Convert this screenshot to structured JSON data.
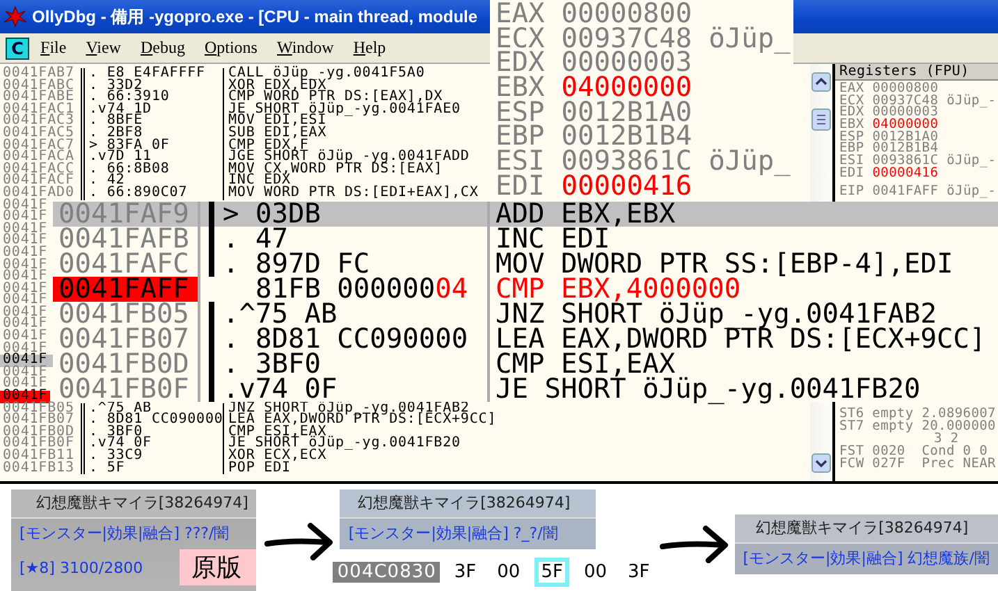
{
  "window": {
    "title": "OllyDbg - 備用 -ygopro.exe - [CPU - main thread, module"
  },
  "menu": {
    "system_button": "C",
    "items": [
      "File",
      "View",
      "Debug",
      "Options",
      "Window",
      "Help"
    ]
  },
  "disassembly": {
    "rows": [
      {
        "address": "0041FAB7",
        "hex": ". E8 E4FAFFFF",
        "instruction": "CALL öJüp_-yg.0041F5A0",
        "selected": false,
        "breakpoint": false
      },
      {
        "address": "0041FABC",
        "hex": ". 33D2",
        "instruction": "XOR EDX,EDX",
        "selected": false,
        "breakpoint": false
      },
      {
        "address": "0041FABE",
        "hex": ". 66:3910",
        "instruction": "CMP WORD PTR DS:[EAX],DX",
        "selected": false,
        "breakpoint": false
      },
      {
        "address": "0041FAC1",
        "hex": ".v74 1D",
        "instruction": "JE SHORT öJüp_-yg.0041FAE0",
        "selected": false,
        "breakpoint": false
      },
      {
        "address": "0041FAC3",
        "hex": ". 8BFE",
        "instruction": "MOV EDI,ESI",
        "selected": false,
        "breakpoint": false
      },
      {
        "address": "0041FAC5",
        "hex": ". 2BF8",
        "instruction": "SUB EDI,EAX",
        "selected": false,
        "breakpoint": false
      },
      {
        "address": "0041FAC7",
        "hex": "> 83FA 0F",
        "instruction": "CMP EDX,F",
        "selected": false,
        "breakpoint": false
      },
      {
        "address": "0041FACA",
        "hex": ".v7D 11",
        "instruction": "JGE SHORT öJüp_-yg.0041FADD",
        "selected": false,
        "breakpoint": false
      },
      {
        "address": "0041FACC",
        "hex": ". 66:8B08",
        "instruction": "MOV CX,WORD PTR DS:[EAX]",
        "selected": false,
        "breakpoint": false
      },
      {
        "address": "0041FACF",
        "hex": ". 42",
        "instruction": "INC EDX",
        "selected": false,
        "breakpoint": false
      },
      {
        "address": "0041FAD0",
        "hex": ". 66:890C07",
        "instruction": "MOV WORD PTR DS:[EDI+EAX],CX",
        "selected": false,
        "breakpoint": false
      },
      {
        "address": "0041F",
        "selected": false,
        "breakpoint": false
      },
      {
        "address": "0041F",
        "selected": false,
        "breakpoint": false
      },
      {
        "address": "0041F",
        "selected": false,
        "breakpoint": false
      },
      {
        "address": "0041F",
        "selected": false,
        "breakpoint": false
      },
      {
        "address": "0041F",
        "selected": false,
        "breakpoint": false
      },
      {
        "address": "0041F",
        "selected": false,
        "breakpoint": false
      },
      {
        "address": "0041F",
        "selected": false,
        "breakpoint": false
      },
      {
        "address": "0041F",
        "selected": false,
        "breakpoint": false
      },
      {
        "address": "0041F",
        "selected": false,
        "breakpoint": false
      },
      {
        "address": "0041F",
        "selected": false,
        "breakpoint": false
      },
      {
        "address": "0041F",
        "selected": false,
        "breakpoint": false
      },
      {
        "address": "0041F",
        "selected": false,
        "breakpoint": false
      },
      {
        "address": "0041F",
        "selected": false,
        "breakpoint": false
      },
      {
        "address": "0041F",
        "selected": true,
        "breakpoint": false
      },
      {
        "address": "0041F",
        "selected": false,
        "breakpoint": false
      },
      {
        "address": "0041F",
        "selected": false,
        "breakpoint": false
      },
      {
        "address": "0041F",
        "selected": false,
        "breakpoint": true
      },
      {
        "address": "0041FB05",
        "hex": ".^75 AB",
        "instruction": "JNZ SHORT öJüp_-yg.0041FAB2",
        "selected": false,
        "breakpoint": false
      },
      {
        "address": "0041FB07",
        "hex": ". 8D81 CC090000",
        "instruction": "LEA EAX,DWORD PTR DS:[ECX+9CC]",
        "selected": false,
        "breakpoint": false
      },
      {
        "address": "0041FB0D",
        "hex": ". 3BF0",
        "instruction": "CMP ESI,EAX",
        "selected": false,
        "breakpoint": false
      },
      {
        "address": "0041FB0F",
        "hex": ".v74 0F",
        "instruction": "JE SHORT öJüp_-yg.0041FB20",
        "selected": false,
        "breakpoint": false
      },
      {
        "address": "0041FB11",
        "hex": ". 33C9",
        "instruction": "XOR ECX,ECX",
        "selected": false,
        "breakpoint": false
      },
      {
        "address": "0041FB13",
        "hex": ". 5F",
        "instruction": "POP EDI",
        "selected": false,
        "breakpoint": false
      }
    ]
  },
  "registers": {
    "title": "Registers (FPU)",
    "lines": [
      {
        "name": "EAX",
        "value": "00000800",
        "changed": false
      },
      {
        "name": "ECX",
        "value": "00937C48",
        "comment": "öJüp_-",
        "changed": false
      },
      {
        "name": "EDX",
        "value": "00000003",
        "changed": false
      },
      {
        "name": "EBX",
        "value": "04000000",
        "changed": true
      },
      {
        "name": "ESP",
        "value": "0012B1A0",
        "changed": false
      },
      {
        "name": "EBP",
        "value": "0012B1B4",
        "changed": false
      },
      {
        "name": "ESI",
        "value": "0093861C",
        "comment": "öJüp_-",
        "changed": false
      },
      {
        "name": "EDI",
        "value": "00000416",
        "changed": true
      }
    ],
    "eip": {
      "name": "EIP",
      "value": "0041FAFF",
      "comment": "öJüp_-"
    },
    "fpu_lines": [
      {
        "kind": "line",
        "text": "ST6 empty 2.0896007"
      },
      {
        "kind": "line",
        "text": "ST7 empty 20.000000"
      },
      {
        "kind": "flags",
        "text": "3 2"
      },
      {
        "kind": "line",
        "text": "FST 0020  Cond 0 0"
      },
      {
        "kind": "line",
        "text": "FCW 027F  Prec NEAR"
      }
    ]
  },
  "register_zoom": {
    "lines": [
      {
        "name": "EAX",
        "value": "00000800",
        "changed": false
      },
      {
        "name": "ECX",
        "value": "00937C48",
        "comment": "öJüp_",
        "changed": false
      },
      {
        "name": "EDX",
        "value": "00000003",
        "changed": false
      },
      {
        "name": "EBX",
        "value": "04000000",
        "changed": true
      },
      {
        "name": "ESP",
        "value": "0012B1A0",
        "changed": false
      },
      {
        "name": "EBP",
        "value": "0012B1B4",
        "changed": false
      },
      {
        "name": "ESI",
        "value": "0093861C",
        "comment": "öJüp_",
        "changed": false
      },
      {
        "name": "EDI",
        "value": "00000416",
        "changed": true
      }
    ]
  },
  "disassembly_zoom": {
    "rows": [
      {
        "address": "0041FAF9",
        "hex": "> 03DB",
        "instruction": "ADD EBX,EBX",
        "selected": true,
        "breakpoint": false,
        "jump_bar": true
      },
      {
        "address": "0041FAFB",
        "hex": ". 47",
        "instruction": "INC EDI",
        "selected": false,
        "breakpoint": false,
        "jump_bar": true
      },
      {
        "address": "0041FAFC",
        "hex": ". 897D FC",
        "instruction": "MOV DWORD PTR SS:[EBP-4],EDI",
        "selected": false,
        "breakpoint": false,
        "jump_bar": true
      },
      {
        "address": "0041FAFF",
        "hex": "  81FB 000000",
        "hex_changed": "04",
        "instruction": "CMP EBX,4000000",
        "selected": false,
        "breakpoint": true,
        "jump_bar": false
      },
      {
        "address": "0041FB05",
        "hex": ".^75 AB",
        "instruction": "JNZ SHORT öJüp_-yg.0041FAB2",
        "selected": false,
        "breakpoint": false,
        "jump_bar": true
      },
      {
        "address": "0041FB07",
        "hex": ". 8D81 CC090000",
        "instruction": "LEA EAX,DWORD PTR DS:[ECX+9CC]",
        "selected": false,
        "breakpoint": false,
        "jump_bar": true
      },
      {
        "address": "0041FB0D",
        "hex": ". 3BF0",
        "instruction": "CMP ESI,EAX",
        "selected": false,
        "breakpoint": false,
        "jump_bar": true
      },
      {
        "address": "0041FB0F",
        "hex": ".v74 0F",
        "instruction": "JE SHORT öJüp_-yg.0041FB20",
        "selected": false,
        "breakpoint": false,
        "jump_bar": true
      }
    ]
  },
  "cards": [
    {
      "title": "幻想魔獣キマイラ[38264974]",
      "type_line": "[モンスター|効果|融合] ???/闇",
      "stats": "[★8] 3100/2800",
      "note": "原版"
    },
    {
      "title": "幻想魔獣キマイラ[38264974]",
      "type_line": "[モンスター|効果|融合] ?_?/闇",
      "dump": {
        "address": "004C0830",
        "bytes": [
          {
            "text": "3F",
            "selected": false
          },
          {
            "text": "00",
            "selected": false
          },
          {
            "text": "5F",
            "selected": true
          },
          {
            "text": "00",
            "selected": false
          },
          {
            "text": "3F",
            "selected": false
          }
        ]
      }
    },
    {
      "title": "幻想魔獣キマイラ[38264974]",
      "type_line": "[モンスター|効果|融合] 幻想魔族/闇"
    }
  ]
}
